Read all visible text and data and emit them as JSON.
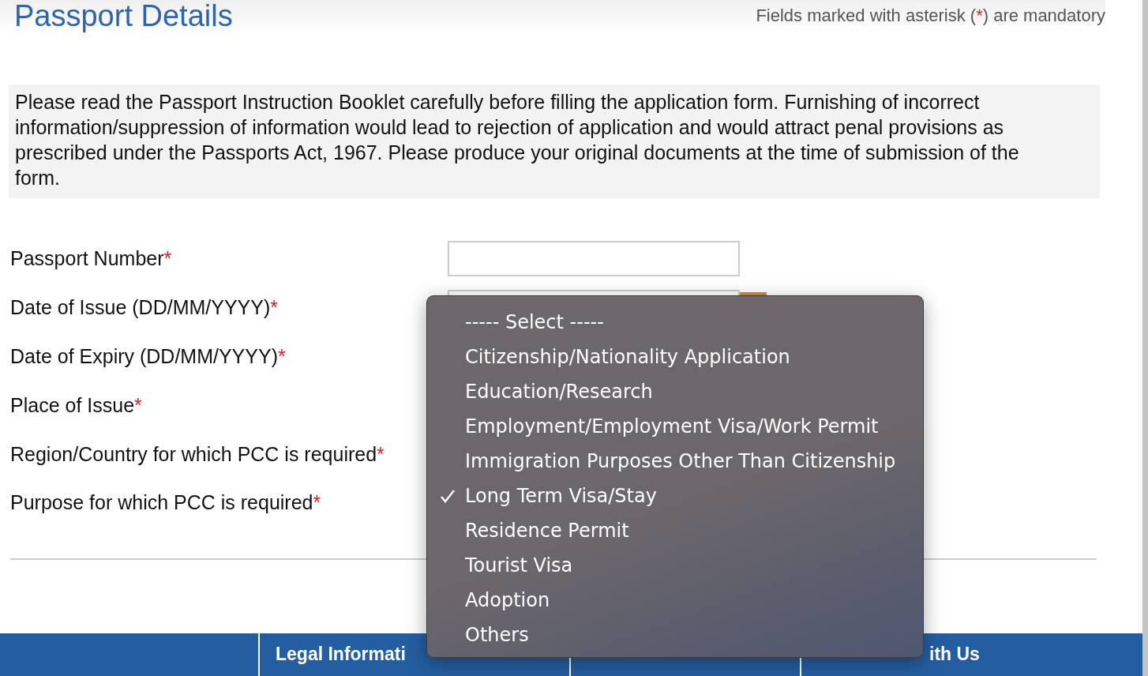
{
  "header": {
    "title": "Passport Details",
    "note": {
      "before": "Fields marked with asterisk (",
      "asterisk": "*",
      "after": ") are mandatory"
    }
  },
  "instructions": "Please read the Passport Instruction Booklet carefully before filling the application form. Furnishing of incorrect information/suppression of information would lead to rejection of application and would attract penal provisions as prescribed under the Passports Act, 1967. Please produce your original documents at the time of submission of the form.",
  "fields": [
    {
      "label": "Passport Number",
      "asterisk": "*",
      "kind": "text"
    },
    {
      "label": "Date of Issue (DD/MM/YYYY)",
      "asterisk": "*",
      "kind": "date"
    },
    {
      "label": "Date of Expiry (DD/MM/YYYY)",
      "asterisk": "*",
      "kind": "hidden"
    },
    {
      "label": "Place of Issue",
      "asterisk": "*",
      "kind": "hidden"
    },
    {
      "label": "Region/Country for which PCC is required",
      "asterisk": "*",
      "kind": "hidden"
    },
    {
      "label": "Purpose for which PCC is required",
      "asterisk": "*",
      "kind": "hidden"
    }
  ],
  "dropdown": {
    "options": [
      {
        "label": "----- Select -----",
        "selected": false
      },
      {
        "label": "Citizenship/Nationality Application",
        "selected": false
      },
      {
        "label": "Education/Research",
        "selected": false
      },
      {
        "label": "Employment/Employment Visa/Work Permit",
        "selected": false
      },
      {
        "label": "Immigration Purposes Other Than Citizenship",
        "selected": false
      },
      {
        "label": "Long Term Visa/Stay",
        "selected": true
      },
      {
        "label": "Residence Permit",
        "selected": false
      },
      {
        "label": "Tourist Visa",
        "selected": false
      },
      {
        "label": "Adoption",
        "selected": false
      },
      {
        "label": "Others",
        "selected": false
      }
    ]
  },
  "footer": {
    "links": [
      "Legal Informati",
      "ith Us"
    ]
  }
}
